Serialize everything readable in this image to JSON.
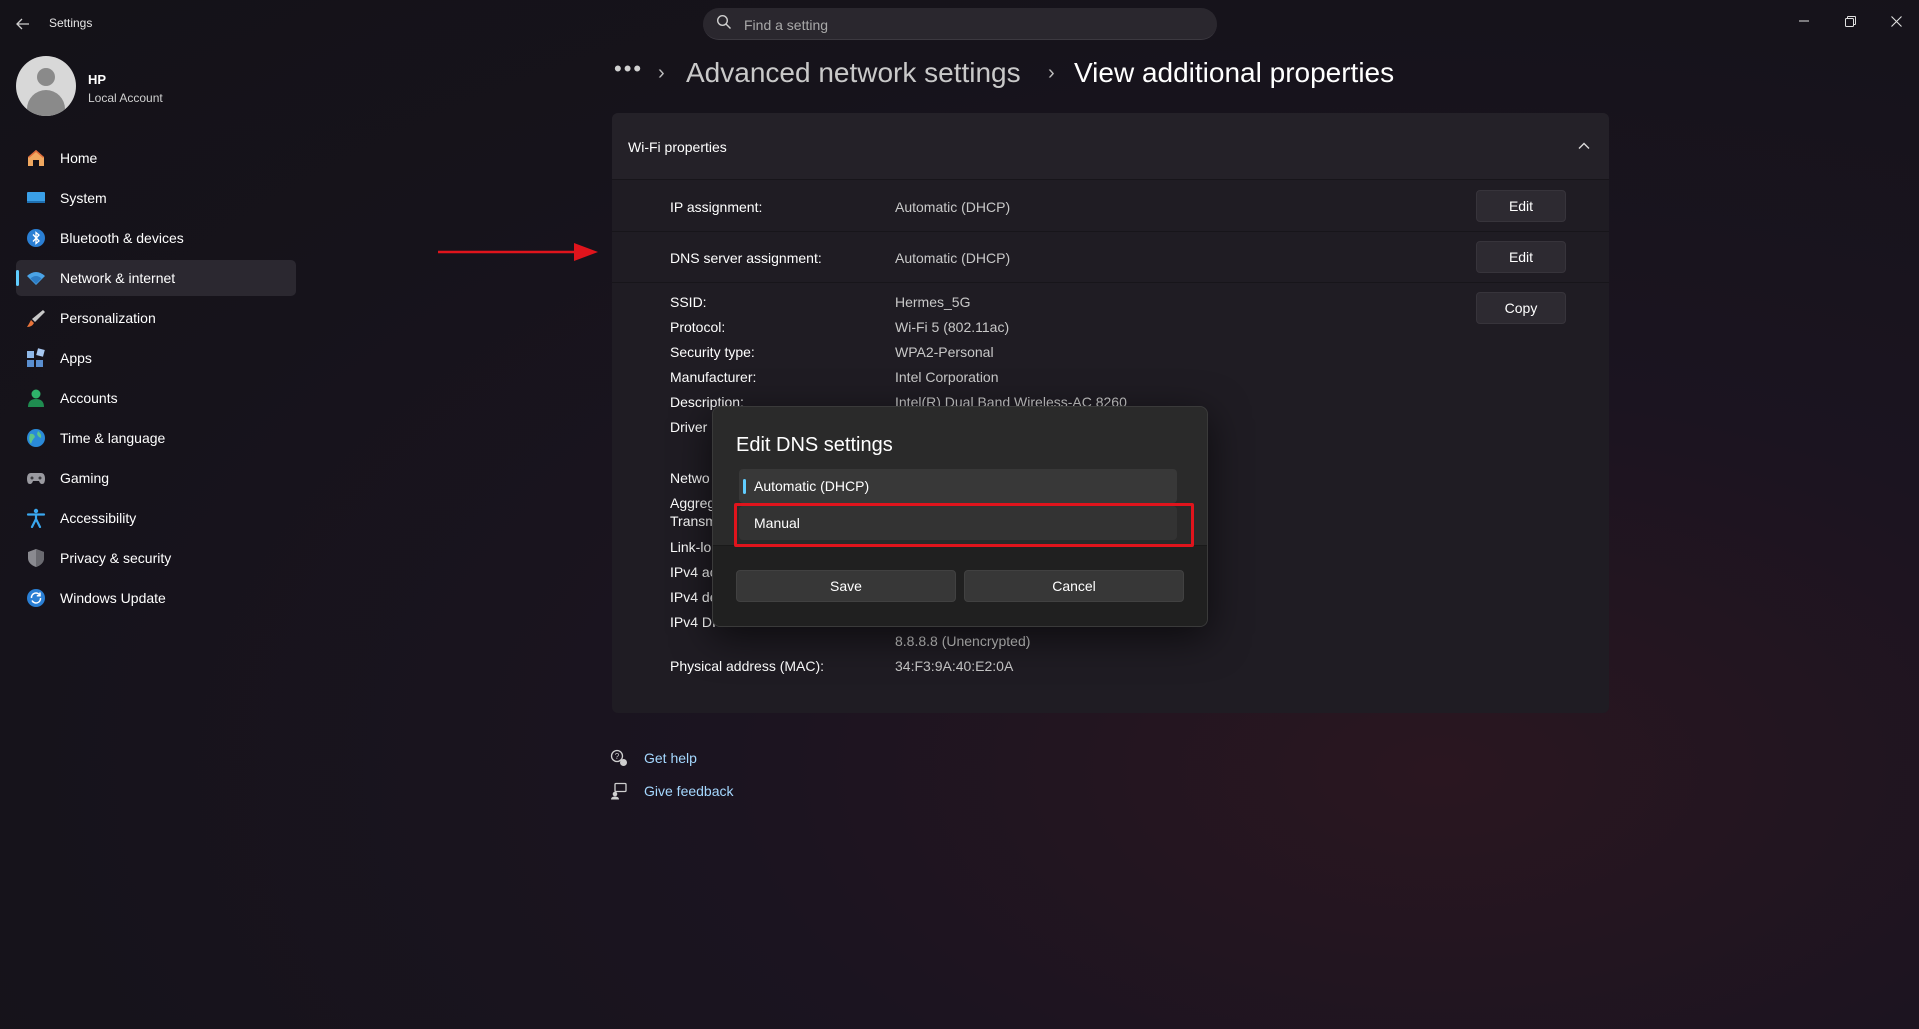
{
  "window": {
    "title": "Settings",
    "back_icon": "back-arrow-icon",
    "controls": [
      "minimize-icon",
      "restore-icon",
      "close-icon"
    ]
  },
  "search": {
    "placeholder": "Find a setting",
    "value": ""
  },
  "profile": {
    "name": "HP",
    "account_type": "Local Account"
  },
  "nav": {
    "active_index": 3,
    "items": [
      {
        "label": "Home",
        "icon": "home-icon"
      },
      {
        "label": "System",
        "icon": "system-icon"
      },
      {
        "label": "Bluetooth & devices",
        "icon": "bluetooth-icon"
      },
      {
        "label": "Network & internet",
        "icon": "wifi-icon"
      },
      {
        "label": "Personalization",
        "icon": "brush-icon"
      },
      {
        "label": "Apps",
        "icon": "apps-icon"
      },
      {
        "label": "Accounts",
        "icon": "person-icon"
      },
      {
        "label": "Time & language",
        "icon": "globe-icon"
      },
      {
        "label": "Gaming",
        "icon": "gamepad-icon"
      },
      {
        "label": "Accessibility",
        "icon": "accessibility-icon"
      },
      {
        "label": "Privacy & security",
        "icon": "shield-icon"
      },
      {
        "label": "Windows Update",
        "icon": "update-icon"
      }
    ]
  },
  "breadcrumb": {
    "more": "•••",
    "separator": "›",
    "items": [
      "Advanced network settings",
      "View additional properties"
    ]
  },
  "wifi_properties": {
    "title": "Wi-Fi properties",
    "collapse_icon": "chevron-up-icon",
    "ip_assignment": {
      "label": "IP assignment:",
      "value": "Automatic (DHCP)",
      "button": "Edit"
    },
    "dns_assignment": {
      "label": "DNS server assignment:",
      "value": "Automatic (DHCP)",
      "button": "Edit"
    },
    "copy_button": "Copy",
    "details": [
      {
        "label": "SSID:",
        "value": "Hermes_5G"
      },
      {
        "label": "Protocol:",
        "value": "Wi-Fi 5 (802.11ac)"
      },
      {
        "label": "Security type:",
        "value": "WPA2-Personal"
      },
      {
        "label": "Manufacturer:",
        "value": "Intel Corporation"
      },
      {
        "label": "Description:",
        "value": "Intel(R) Dual Band Wireless-AC 8260"
      }
    ],
    "partial_labels": [
      "Driver",
      "Netwo",
      "Aggreg",
      "Transm",
      "Link-lo",
      "IPv4 ac",
      "IPv4 de",
      "IPv4 DI"
    ],
    "dns_extra": "8.8.8.8 (Unencrypted)",
    "mac": {
      "label": "Physical address (MAC):",
      "value": "34:F3:9A:40:E2:0A"
    }
  },
  "help": {
    "get_help": "Get help",
    "give_feedback": "Give feedback"
  },
  "dialog": {
    "title": "Edit DNS settings",
    "options": [
      "Automatic (DHCP)",
      "Manual"
    ],
    "selected_index": 0,
    "save": "Save",
    "cancel": "Cancel"
  },
  "annotation_color": "#e0141c",
  "accent_color": "#60cdff"
}
